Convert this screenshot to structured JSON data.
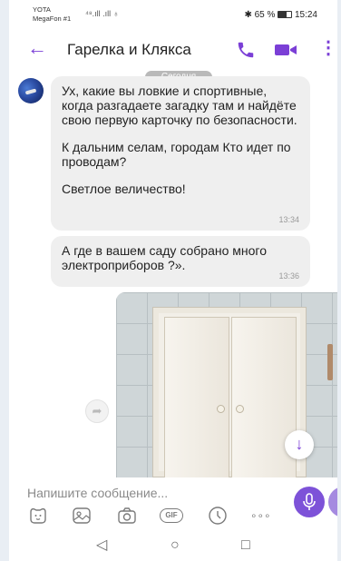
{
  "status_bar": {
    "carrier_line1": "YOTA",
    "carrier_line2": "MegaFon #1",
    "signal_text": "⁴⁸.ıll .ıll ♁",
    "battery_percent": "65 %",
    "time": "15:24"
  },
  "header": {
    "title": "Гарелка и Клякса"
  },
  "chat": {
    "date_label": "Сегодня",
    "messages": [
      {
        "paragraphs": [
          "Ух, какие вы ловкие и спортивные, когда разгадаете загадку там и найдёте свою первую карточку по безопасности.",
          "К дальним селам, городам Кто идет по проводам?",
          "Светлое величество!"
        ],
        "time": "13:34"
      },
      {
        "paragraphs": [
          "А где в вашем саду собрано много электроприборов ?»."
        ],
        "time": "13:36"
      }
    ]
  },
  "composer": {
    "placeholder": "Напишите сообщение...",
    "gif_label": "GIF",
    "more_label": "∘∘∘"
  },
  "colors": {
    "accent": "#7b3fd6",
    "bubble": "#efefef",
    "mic_button": "#7d52d8"
  }
}
